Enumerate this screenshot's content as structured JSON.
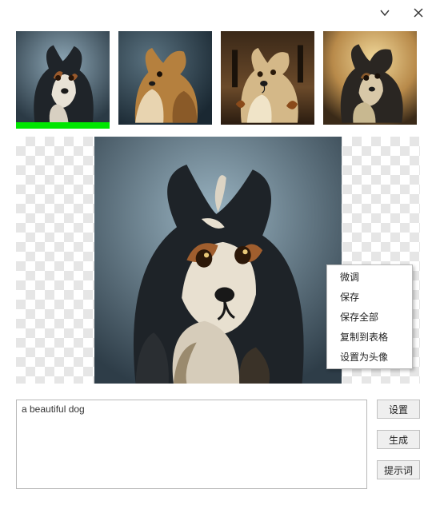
{
  "titlebar": {
    "minimize_aria": "minimize",
    "close_aria": "close"
  },
  "thumbnails": [
    {
      "selected": true
    },
    {
      "selected": false
    },
    {
      "selected": false
    },
    {
      "selected": false
    }
  ],
  "context_menu": {
    "items": [
      "微调",
      "保存",
      "保存全部",
      "复制到表格",
      "设置为头像"
    ]
  },
  "prompt": {
    "value": "a beautiful dog"
  },
  "buttons": {
    "settings": "设置",
    "generate": "生成",
    "prompt_words": "提示词"
  }
}
